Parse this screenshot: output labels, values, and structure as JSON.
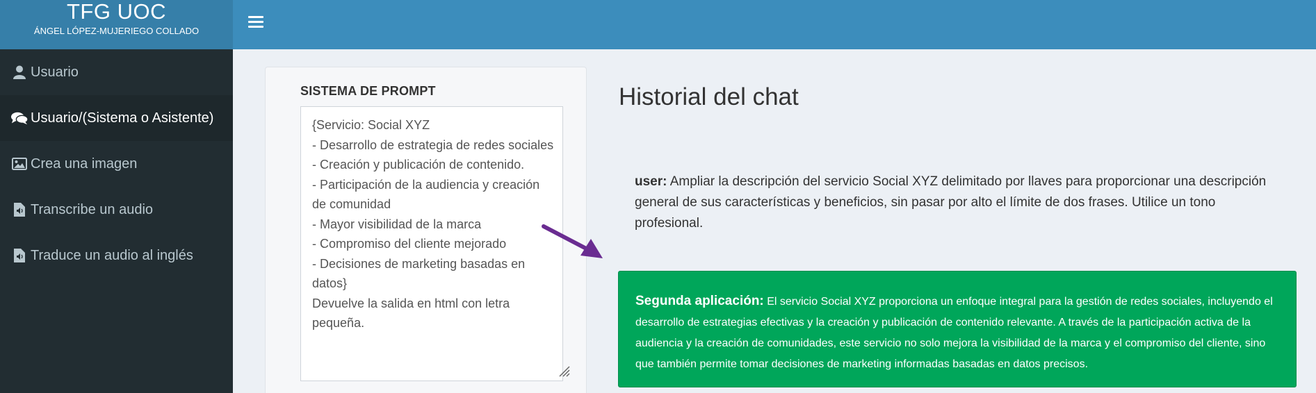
{
  "header": {
    "logo_title": "TFG UOC",
    "logo_subtitle": "ÁNGEL LÓPEZ-MUJERIEGO COLLADO",
    "menu_icon": "hamburger-icon"
  },
  "sidebar": {
    "items": [
      {
        "label": "Usuario",
        "icon": "user-icon",
        "active": false
      },
      {
        "label": "Usuario/(Sistema o Asistente)",
        "icon": "comments-icon",
        "active": true
      },
      {
        "label": "Crea una imagen",
        "icon": "image-icon",
        "active": false
      },
      {
        "label": "Transcribe un audio",
        "icon": "audio-file-icon",
        "active": false
      },
      {
        "label": "Traduce un audio al inglés",
        "icon": "audio-file-icon",
        "active": false
      }
    ]
  },
  "prompt": {
    "label": "SISTEMA DE PROMPT",
    "value": "{Servicio: Social XYZ\n- Desarrollo de estrategia de redes sociales\n- Creación y publicación de contenido.\n- Participación de la audiencia y creación de comunidad\n- Mayor visibilidad de la marca\n- Compromiso del cliente mejorado\n- Decisiones de marketing basadas en datos}\nDevuelve la salida en html con letra pequeña."
  },
  "chat": {
    "title": "Historial del chat",
    "user_role": "user:",
    "user_text": " Ampliar la descripción del servicio Social XYZ delimitado por llaves para proporcionar una descripción general de sus características y beneficios, sin pasar por alto el límite de dos frases. Utilice un tono profesional.",
    "assistant_role": "Segunda aplicación:",
    "assistant_text": " El servicio Social XYZ proporciona un enfoque integral para la gestión de redes sociales, incluyendo el desarrollo de estrategias efectivas y la creación y publicación de contenido relevante. A través de la participación activa de la audiencia y la creación de comunidades, este servicio no solo mejora la visibilidad de la marca y el compromiso del cliente, sino que también permite tomar decisiones de marketing informadas basadas en datos precisos."
  },
  "colors": {
    "navbar": "#3c8dbc",
    "logo_bg": "#367fa9",
    "sidebar_bg": "#222d32",
    "assistant_bg": "#00a65a",
    "arrow": "#6a2c91"
  }
}
